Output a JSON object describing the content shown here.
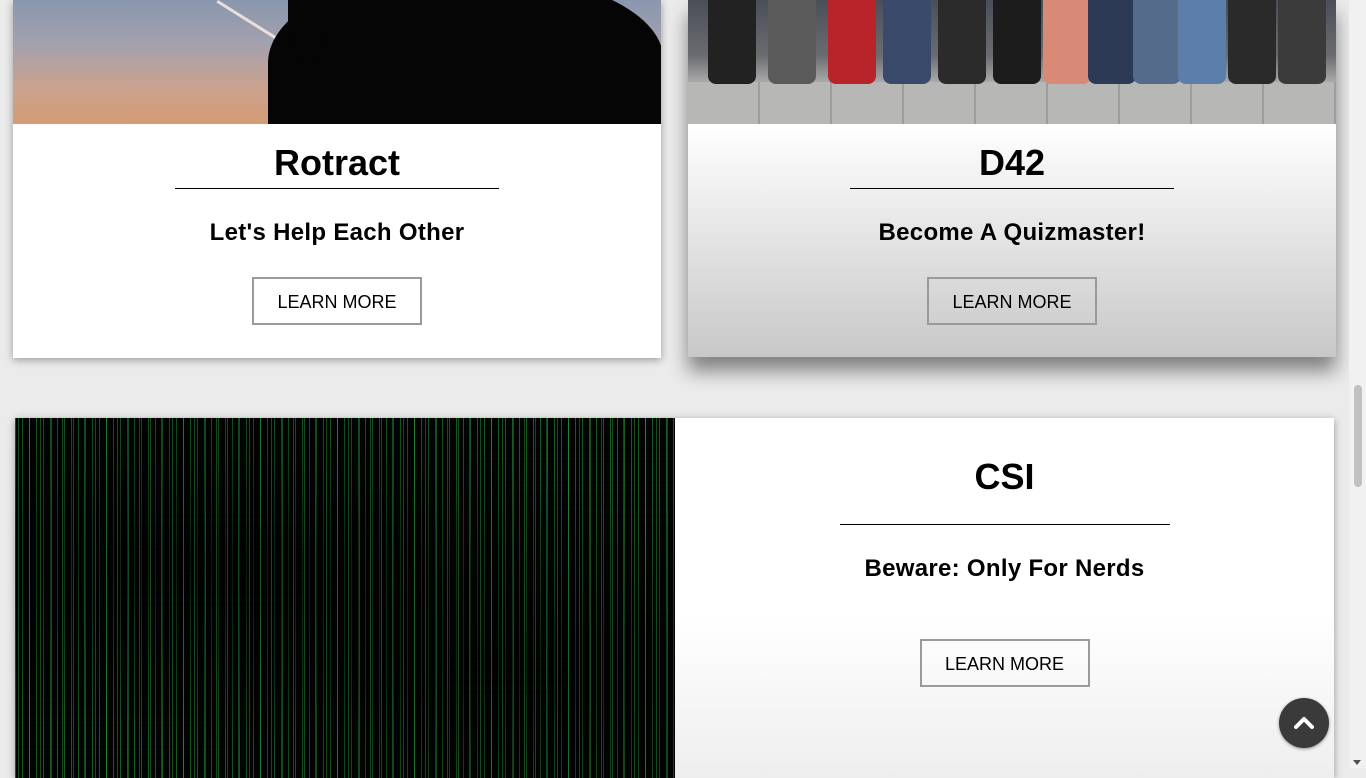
{
  "cards": [
    {
      "title": "Rotract",
      "tagline": "Let's Help Each Other",
      "button_label": "LEARN MORE"
    },
    {
      "title": "D42",
      "tagline": "Become A Quizmaster!",
      "button_label": "LEARN MORE"
    },
    {
      "title": "CSI",
      "tagline": "Beware: Only For Nerds",
      "button_label": "LEARN MORE"
    }
  ],
  "scroll_top_icon": "chevron-up-icon",
  "colors": {
    "page_background": "#ebebeb",
    "scroll_top_button": "#3a3a3a",
    "button_border": "#9a9a9a"
  }
}
